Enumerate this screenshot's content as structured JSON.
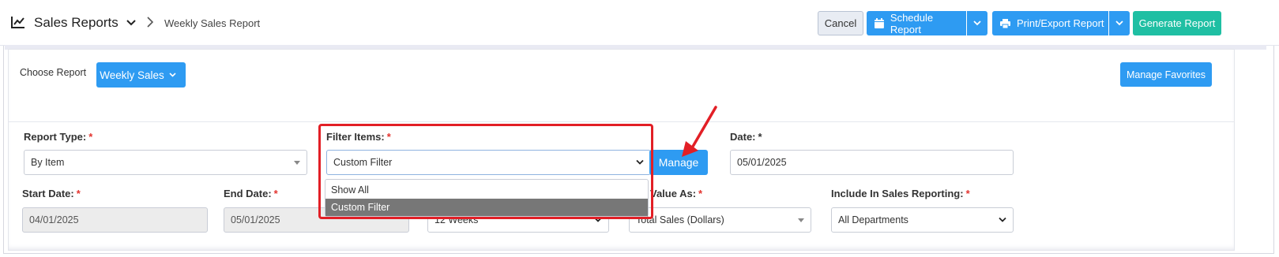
{
  "header": {
    "app_title": "Sales Reports",
    "breadcrumb_current": "Weekly Sales Report",
    "cancel_label": "Cancel",
    "schedule_label": "Schedule Report",
    "print_label": "Print/Export Report",
    "generate_label": "Generate Report"
  },
  "report_picker": {
    "label": "Choose Report",
    "selected": "Weekly Sales",
    "favorites_label": "Manage Favorites"
  },
  "form": {
    "report_type": {
      "label": "Report Type:",
      "required": "*",
      "value": "By Item"
    },
    "filter_items": {
      "label": "Filter Items:",
      "required": "*",
      "value": "Custom Filter",
      "manage_label": "Manage"
    },
    "date": {
      "label": "Date:",
      "required": "*",
      "value": "05/01/2025"
    },
    "start_date": {
      "label": "Start Date:",
      "required": "*",
      "value": "04/01/2025"
    },
    "end_date": {
      "label": "End Date:",
      "required": "*",
      "value": "05/01/2025"
    },
    "period": {
      "value": "12 Weeks"
    },
    "value_as": {
      "label": "Value As:",
      "required": "*",
      "value": "Total Sales (Dollars)"
    },
    "include": {
      "label": "Include In Sales Reporting:",
      "required": "*",
      "value": "All Departments"
    }
  },
  "filter_dropdown": {
    "options": [
      "Show All",
      "Custom Filter"
    ],
    "highlighted": "Custom Filter"
  },
  "colors": {
    "primary": "#2e9bf2",
    "success": "#1fbfa3",
    "required": "#e3342f",
    "annotation": "#e21f26"
  }
}
